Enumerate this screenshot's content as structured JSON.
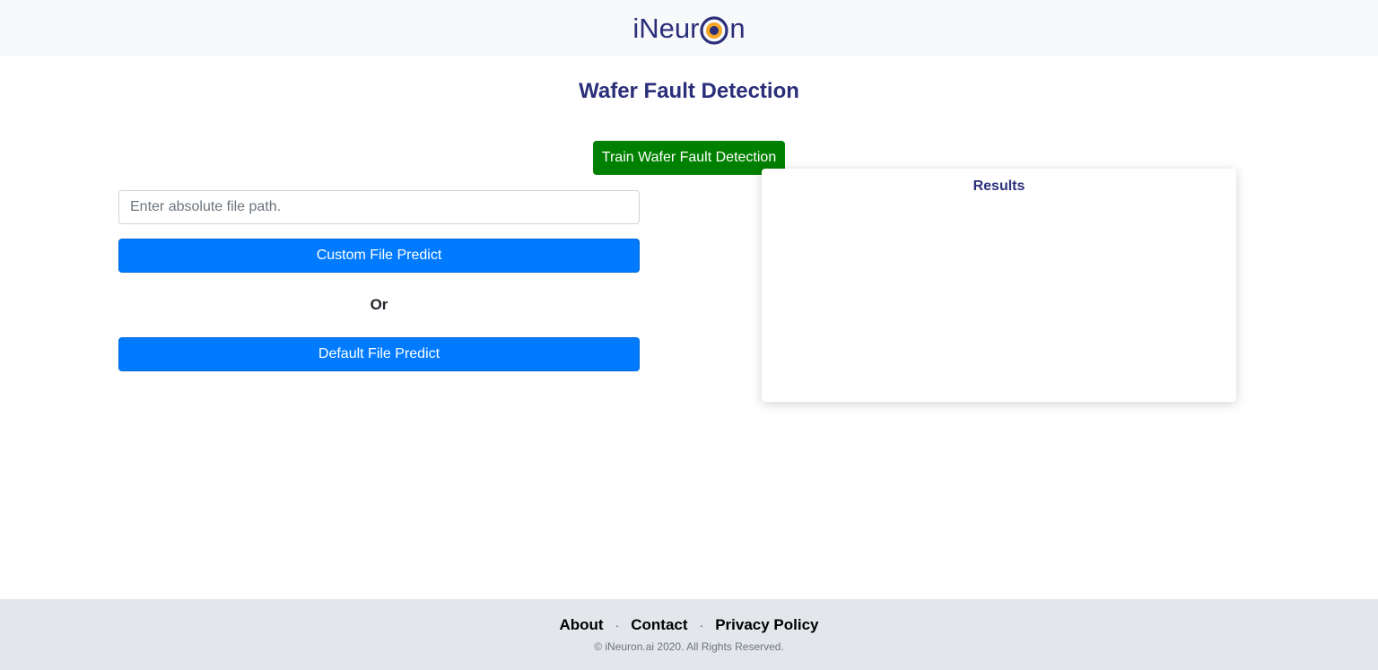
{
  "header": {
    "logo_prefix": "iNeur",
    "logo_suffix": "n",
    "logo_icon": "target-ring-icon",
    "logo_alt": "iNeuron"
  },
  "main": {
    "title": "Wafer Fault Detection",
    "train_button_label": "Train Wafer Fault Detection",
    "file_path_placeholder": "Enter absolute file path.",
    "file_path_value": "",
    "custom_predict_label": "Custom File Predict",
    "or_label": "Or",
    "default_predict_label": "Default File Predict",
    "results_title": "Results"
  },
  "footer": {
    "links": [
      "About",
      "Contact",
      "Privacy Policy"
    ],
    "separator": "·",
    "copyright": "© iNeuron.ai 2020. All Rights Reserved."
  },
  "colors": {
    "brand_navy": "#2b2f7a",
    "train_green": "#008000",
    "predict_blue": "#007bff",
    "logo_orange": "#f5a623",
    "navbar_bg": "#f8f9fa",
    "footer_bg": "#e3e7eb"
  }
}
